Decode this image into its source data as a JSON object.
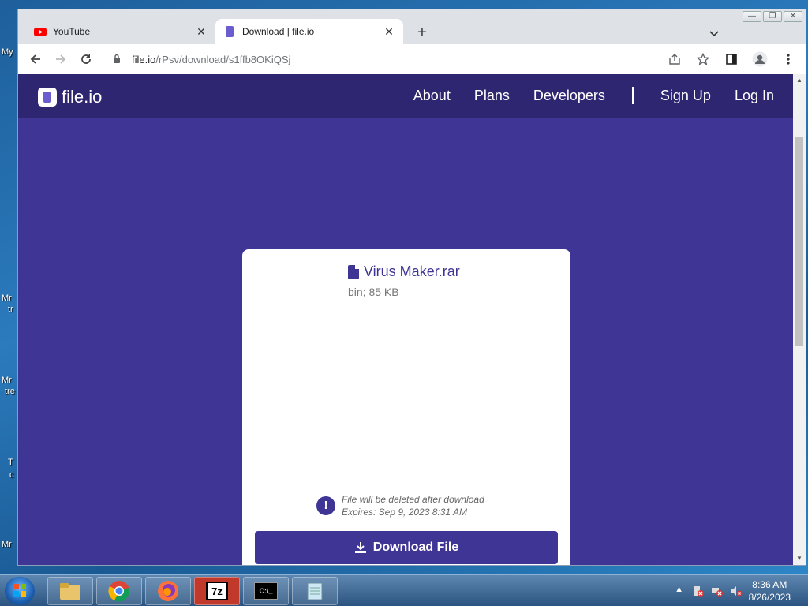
{
  "desktop": {
    "labels": [
      "My",
      "Mr",
      "tr",
      "Mr",
      "tre",
      "T",
      "c",
      "Mr"
    ]
  },
  "browser": {
    "window_controls": {
      "minimize": "—",
      "restore": "❐",
      "close": "✕"
    },
    "tabs": [
      {
        "title": "YouTube",
        "favicon": "youtube-icon",
        "active": false
      },
      {
        "title": "Download | file.io",
        "favicon": "fileio-icon",
        "active": true
      }
    ],
    "new_tab": "+",
    "tab_menu": "⌄",
    "address": {
      "host": "file.io",
      "path": "/rPsv/download/s1ffb8OKiQSj"
    }
  },
  "site": {
    "brand": "file.io",
    "nav": {
      "about": "About",
      "plans": "Plans",
      "developers": "Developers",
      "signup": "Sign Up",
      "login": "Log In"
    },
    "file": {
      "name": "Virus Maker.rar",
      "meta": "bin; 85 KB"
    },
    "notice": {
      "line1": "File will be deleted after download",
      "line2": "Expires: Sep 9, 2023 8:31 AM"
    },
    "download_label": "Download File"
  },
  "taskbar": {
    "items": [
      "file-explorer",
      "chrome",
      "firefox",
      "7zip",
      "cmd",
      "notepad"
    ],
    "sevenzip_label": "7z",
    "cmd_label": "C:\\_",
    "clock": {
      "time": "8:36 AM",
      "date": "8/26/2023"
    }
  },
  "colors": {
    "page_bg": "#3f3595",
    "nav_bg": "#2e2670",
    "accent": "#3f3595"
  }
}
